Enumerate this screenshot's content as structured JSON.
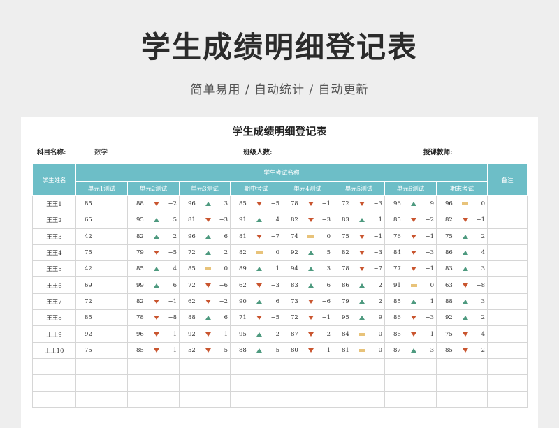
{
  "banner": {
    "title": "学生成绩明细登记表",
    "subtitle": "简单易用  /  自动统计  /  自动更新"
  },
  "sheet": {
    "title": "学生成绩明细登记表",
    "subject_label": "科目名称:",
    "subject_value": "数学",
    "class_size_label": "班级人数:",
    "class_size_value": "",
    "teacher_label": "授课教师:",
    "teacher_value": ""
  },
  "colors": {
    "header": "#6dbec7",
    "up": "#4e9a7f",
    "down": "#c9552f",
    "flat": "#e8c37a"
  },
  "table": {
    "name_header": "学生姓名",
    "group_header": "学生考试名称",
    "notes_header": "备注",
    "exam_headers": [
      "单元1测试",
      "单元2测试",
      "单元3测试",
      "期中考试",
      "单元4测试",
      "单元5测试",
      "单元6测试",
      "期末考试"
    ],
    "rows": [
      {
        "name": "王王1",
        "base": "85",
        "exams": [
          {
            "score": "88",
            "trend": "down",
            "diff": "−2"
          },
          {
            "score": "96",
            "trend": "up",
            "diff": "3"
          },
          {
            "score": "85",
            "trend": "down",
            "diff": "−5"
          },
          {
            "score": "78",
            "trend": "down",
            "diff": "−1"
          },
          {
            "score": "72",
            "trend": "down",
            "diff": "−3"
          },
          {
            "score": "96",
            "trend": "up",
            "diff": "9"
          },
          {
            "score": "96",
            "trend": "flat",
            "diff": "0"
          }
        ]
      },
      {
        "name": "王王2",
        "base": "65",
        "exams": [
          {
            "score": "95",
            "trend": "up",
            "diff": "5"
          },
          {
            "score": "81",
            "trend": "down",
            "diff": "−3"
          },
          {
            "score": "91",
            "trend": "up",
            "diff": "4"
          },
          {
            "score": "82",
            "trend": "down",
            "diff": "−3"
          },
          {
            "score": "83",
            "trend": "up",
            "diff": "1"
          },
          {
            "score": "85",
            "trend": "down",
            "diff": "−2"
          },
          {
            "score": "82",
            "trend": "down",
            "diff": "−1"
          }
        ]
      },
      {
        "name": "王王3",
        "base": "42",
        "exams": [
          {
            "score": "82",
            "trend": "up",
            "diff": "2"
          },
          {
            "score": "96",
            "trend": "up",
            "diff": "6"
          },
          {
            "score": "81",
            "trend": "down",
            "diff": "−7"
          },
          {
            "score": "74",
            "trend": "flat",
            "diff": "0"
          },
          {
            "score": "75",
            "trend": "down",
            "diff": "−1"
          },
          {
            "score": "76",
            "trend": "down",
            "diff": "−1"
          },
          {
            "score": "75",
            "trend": "up",
            "diff": "2"
          }
        ]
      },
      {
        "name": "王王4",
        "base": "75",
        "exams": [
          {
            "score": "79",
            "trend": "down",
            "diff": "−5"
          },
          {
            "score": "72",
            "trend": "up",
            "diff": "2"
          },
          {
            "score": "82",
            "trend": "flat",
            "diff": "0"
          },
          {
            "score": "92",
            "trend": "up",
            "diff": "5"
          },
          {
            "score": "82",
            "trend": "down",
            "diff": "−3"
          },
          {
            "score": "84",
            "trend": "down",
            "diff": "−3"
          },
          {
            "score": "86",
            "trend": "up",
            "diff": "4"
          }
        ]
      },
      {
        "name": "王王5",
        "base": "42",
        "exams": [
          {
            "score": "85",
            "trend": "up",
            "diff": "4"
          },
          {
            "score": "85",
            "trend": "flat",
            "diff": "0"
          },
          {
            "score": "89",
            "trend": "up",
            "diff": "1"
          },
          {
            "score": "94",
            "trend": "up",
            "diff": "3"
          },
          {
            "score": "78",
            "trend": "down",
            "diff": "−7"
          },
          {
            "score": "77",
            "trend": "down",
            "diff": "−1"
          },
          {
            "score": "83",
            "trend": "up",
            "diff": "3"
          }
        ]
      },
      {
        "name": "王王6",
        "base": "69",
        "exams": [
          {
            "score": "99",
            "trend": "up",
            "diff": "6"
          },
          {
            "score": "72",
            "trend": "down",
            "diff": "−6"
          },
          {
            "score": "62",
            "trend": "down",
            "diff": "−3"
          },
          {
            "score": "83",
            "trend": "up",
            "diff": "6"
          },
          {
            "score": "86",
            "trend": "up",
            "diff": "2"
          },
          {
            "score": "91",
            "trend": "flat",
            "diff": "0"
          },
          {
            "score": "63",
            "trend": "down",
            "diff": "−8"
          }
        ]
      },
      {
        "name": "王王7",
        "base": "72",
        "exams": [
          {
            "score": "82",
            "trend": "down",
            "diff": "−1"
          },
          {
            "score": "62",
            "trend": "down",
            "diff": "−2"
          },
          {
            "score": "90",
            "trend": "up",
            "diff": "6"
          },
          {
            "score": "73",
            "trend": "down",
            "diff": "−6"
          },
          {
            "score": "79",
            "trend": "up",
            "diff": "2"
          },
          {
            "score": "85",
            "trend": "up",
            "diff": "1"
          },
          {
            "score": "88",
            "trend": "up",
            "diff": "3"
          }
        ]
      },
      {
        "name": "王王8",
        "base": "85",
        "exams": [
          {
            "score": "78",
            "trend": "down",
            "diff": "−8"
          },
          {
            "score": "88",
            "trend": "up",
            "diff": "6"
          },
          {
            "score": "71",
            "trend": "down",
            "diff": "−5"
          },
          {
            "score": "72",
            "trend": "down",
            "diff": "−1"
          },
          {
            "score": "95",
            "trend": "up",
            "diff": "9"
          },
          {
            "score": "86",
            "trend": "down",
            "diff": "−3"
          },
          {
            "score": "92",
            "trend": "up",
            "diff": "2"
          }
        ]
      },
      {
        "name": "王王9",
        "base": "92",
        "exams": [
          {
            "score": "96",
            "trend": "down",
            "diff": "−1"
          },
          {
            "score": "92",
            "trend": "down",
            "diff": "−1"
          },
          {
            "score": "95",
            "trend": "up",
            "diff": "2"
          },
          {
            "score": "87",
            "trend": "down",
            "diff": "−2"
          },
          {
            "score": "84",
            "trend": "flat",
            "diff": "0"
          },
          {
            "score": "86",
            "trend": "down",
            "diff": "−1"
          },
          {
            "score": "75",
            "trend": "down",
            "diff": "−4"
          }
        ]
      },
      {
        "name": "王王10",
        "base": "75",
        "exams": [
          {
            "score": "85",
            "trend": "down",
            "diff": "−1"
          },
          {
            "score": "52",
            "trend": "down",
            "diff": "−5"
          },
          {
            "score": "88",
            "trend": "up",
            "diff": "5"
          },
          {
            "score": "80",
            "trend": "down",
            "diff": "−1"
          },
          {
            "score": "81",
            "trend": "flat",
            "diff": "0"
          },
          {
            "score": "87",
            "trend": "up",
            "diff": "3"
          },
          {
            "score": "85",
            "trend": "down",
            "diff": "−2"
          }
        ]
      }
    ],
    "empty_rows": 3
  }
}
